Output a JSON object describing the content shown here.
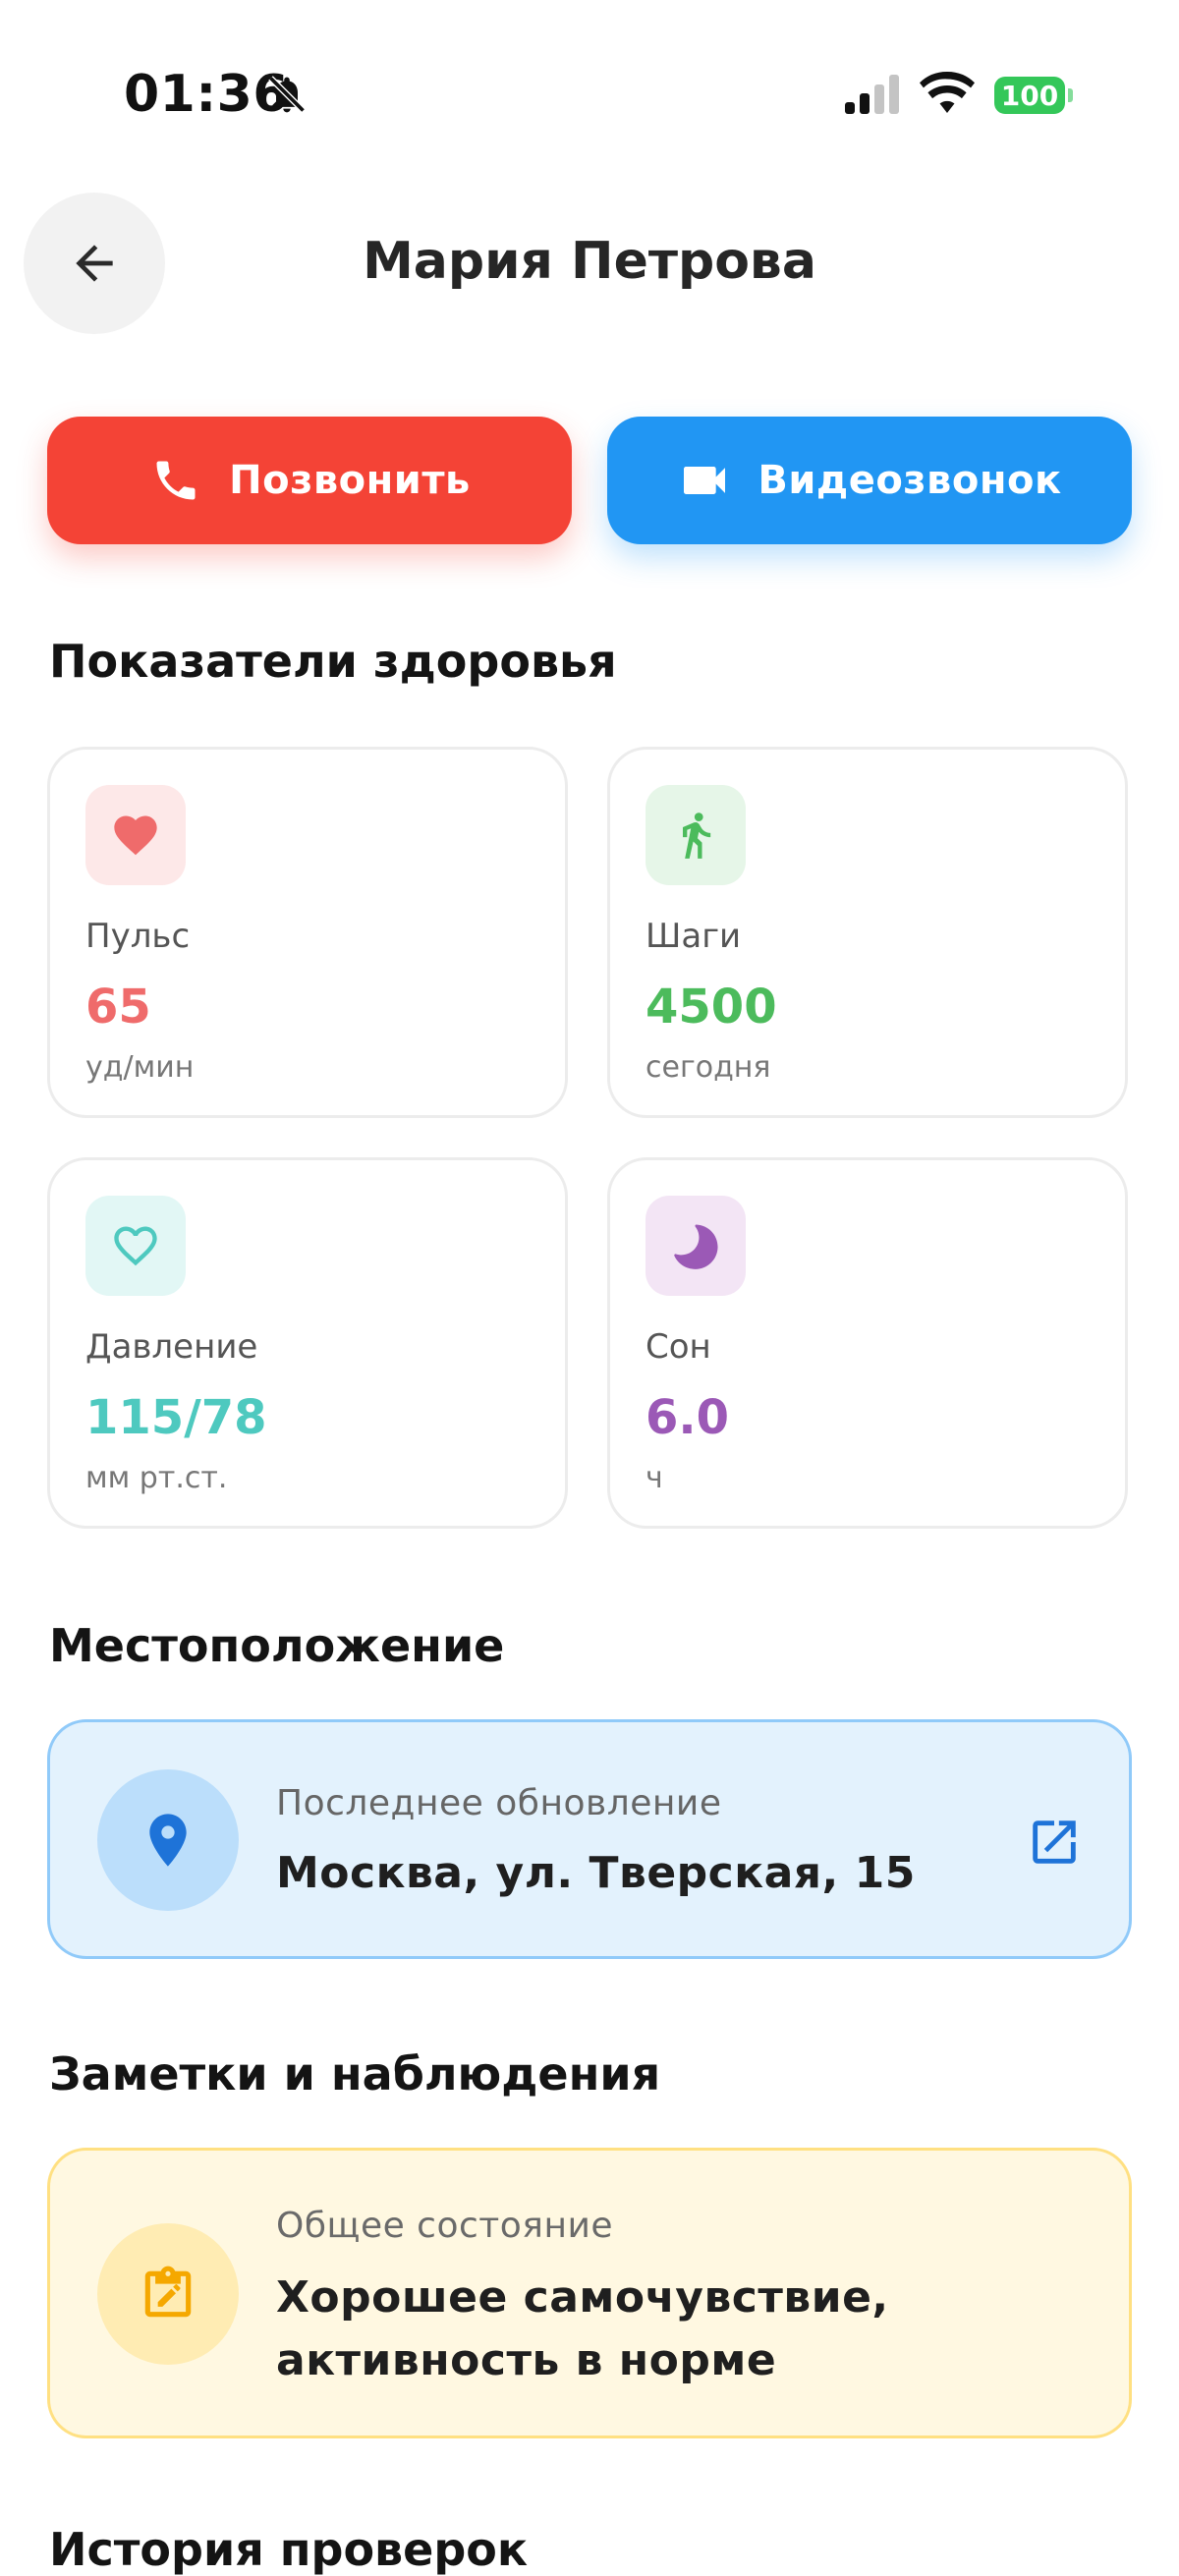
{
  "status_bar": {
    "time": "01:36",
    "battery": "100",
    "icons": [
      "bell-off-icon",
      "signal-icon",
      "wifi-icon",
      "battery-icon"
    ]
  },
  "header": {
    "title": "Мария Петрова",
    "back_icon": "arrow-left-icon"
  },
  "actions": {
    "call_label": "Позвонить",
    "call_icon": "phone-icon",
    "call_color": "#f44336",
    "video_label": "Видеозвонок",
    "video_icon": "videocam-icon",
    "video_color": "#2196f3"
  },
  "health": {
    "section_title": "Показатели здоровья",
    "metrics": [
      {
        "label": "Пульс",
        "value": "65",
        "unit": "уд/мин",
        "icon": "heart-icon",
        "color": "#ef6b6b",
        "bg": "#fde8e8"
      },
      {
        "label": "Шаги",
        "value": "4500",
        "unit": "сегодня",
        "icon": "walking-icon",
        "color": "#4cbb5c",
        "bg": "#e6f6e8"
      },
      {
        "label": "Давление",
        "value": "115/78",
        "unit": "мм рт.ст.",
        "icon": "heart-outline-icon",
        "color": "#4ec9bf",
        "bg": "#e2f7f5"
      },
      {
        "label": "Сон",
        "value": "6.0",
        "unit": "ч",
        "icon": "moon-icon",
        "color": "#9b59b6",
        "bg": "#f3e5f5"
      }
    ]
  },
  "location": {
    "section_title": "Местоположение",
    "caption": "Последнее обновление",
    "address": "Москва, ул. Тверская, 15",
    "icon": "location-pin-icon",
    "action_icon": "open-external-icon"
  },
  "notes": {
    "section_title": "Заметки и наблюдения",
    "caption": "Общее состояние",
    "text": "Хорошее самочувствие, активность в норме",
    "icon": "assignment-edit-icon"
  },
  "history": {
    "section_title": "История проверок"
  }
}
